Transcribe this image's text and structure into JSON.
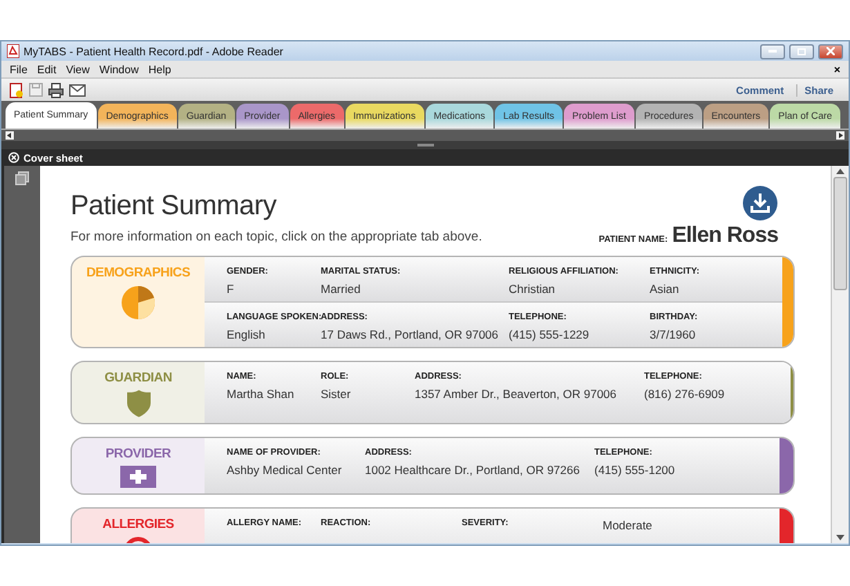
{
  "window": {
    "title": "MyTABS - Patient Health Record.pdf - Adobe Reader"
  },
  "menu": [
    "File",
    "Edit",
    "View",
    "Window",
    "Help"
  ],
  "menu_close": "×",
  "toolbar": {
    "actions": [
      "Comment",
      "Share"
    ]
  },
  "tabs": [
    {
      "label": "Patient Summary",
      "selected": true,
      "color": "#f4f4f4"
    },
    {
      "label": "Demographics",
      "selected": false,
      "color": "#f3b45a"
    },
    {
      "label": "Guardian",
      "selected": false,
      "color": "#b3b184"
    },
    {
      "label": "Provider",
      "selected": false,
      "color": "#a996c9"
    },
    {
      "label": "Allergies",
      "selected": false,
      "color": "#ec6a6a"
    },
    {
      "label": "Immunizations",
      "selected": false,
      "color": "#e9d960"
    },
    {
      "label": "Medications",
      "selected": false,
      "color": "#a9d8dc"
    },
    {
      "label": "Lab Results",
      "selected": false,
      "color": "#6fc3e6"
    },
    {
      "label": "Problem List",
      "selected": false,
      "color": "#de9ccd"
    },
    {
      "label": "Procedures",
      "selected": false,
      "color": "#b3b3b3"
    },
    {
      "label": "Encounters",
      "selected": false,
      "color": "#bc9f84"
    },
    {
      "label": "Plan of Care",
      "selected": false,
      "color": "#bcd9a6"
    }
  ],
  "cover_sheet": {
    "title": "Cover sheet"
  },
  "document": {
    "title": "Patient Summary",
    "subtitle": "For more information on each topic, click on the appropriate tab above.",
    "patient_label": "PATIENT NAME:",
    "patient_name": "Ellen Ross",
    "cards": [
      {
        "kind": "pie",
        "title": "DEMOGRAPHICS",
        "color": "#f7a21b",
        "rows": [
          [
            {
              "label": "GENDER:",
              "value": "F"
            },
            {
              "label": "MARITAL STATUS:",
              "value": "Married"
            },
            {
              "label": "RELIGIOUS AFFILIATION:",
              "value": "Christian"
            },
            {
              "label": "ETHNICITY:",
              "value": "Asian"
            }
          ],
          [
            {
              "label": "LANGUAGE SPOKEN:",
              "value": "English"
            },
            {
              "label": "ADDRESS:",
              "value": "17 Daws Rd., Portland, OR 97006"
            },
            {
              "label": "TELEPHONE:",
              "value": "(415) 555-1229"
            },
            {
              "label": "BIRTHDAY:",
              "value": "3/7/1960"
            }
          ]
        ]
      },
      {
        "kind": "shield",
        "title": "GUARDIAN",
        "color": "#8e8f45",
        "rows": [
          [
            {
              "label": "NAME:",
              "value": "Martha Shan"
            },
            {
              "label": "ROLE:",
              "value": "Sister"
            },
            {
              "label": "ADDRESS:",
              "value": "1357 Amber Dr., Beaverton, OR 97006"
            },
            {
              "label": "TELEPHONE:",
              "value": "(816) 276-6909"
            }
          ]
        ]
      },
      {
        "kind": "cross",
        "title": "PROVIDER",
        "color": "#8b67aa",
        "rows": [
          [
            {
              "label": "NAME OF PROVIDER:",
              "value": "Ashby Medical Center"
            },
            {
              "label": "ADDRESS:",
              "value": "1002 Healthcare Dr., Portland, OR 97266"
            },
            {
              "label": "TELEPHONE:",
              "value": "(415) 555-1200"
            }
          ]
        ]
      },
      {
        "kind": "alert",
        "title": "ALLERGIES",
        "color": "#e3262b",
        "rows": [
          [
            {
              "label": "ALLERGY NAME:"
            },
            {
              "label": "REACTION:"
            },
            {
              "label": "SEVERITY:"
            },
            {
              "value": "Moderate"
            }
          ]
        ]
      }
    ]
  }
}
